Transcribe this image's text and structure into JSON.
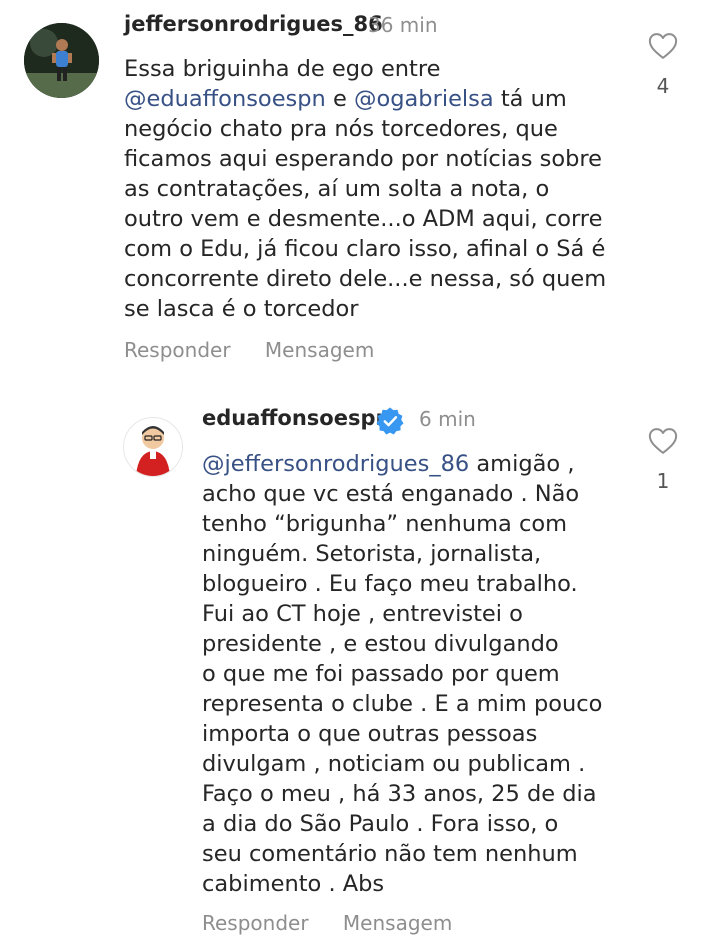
{
  "comments": [
    {
      "username": "jeffersonrodrigues_86",
      "time": "36 min",
      "verified": false,
      "avatar_icon": "user-photo",
      "lines": [
        "Essa briguinha de ego entre",
        "@eduaffonsoespn e @ogabrielsa tá um",
        "negócio chato pra nós torcedores, que",
        "ficamos aqui esperando por notícias sobre",
        "as contratações, aí um solta a nota, o",
        "outro vem e desmente...o ADM aqui, corre",
        "com o Edu, já ficou claro isso, afinal o Sá é",
        "concorrente direto dele...e nessa, só quem",
        "se lasca é o torcedor"
      ],
      "mentions": [
        "@eduaffonsoespn",
        "@ogabrielsa"
      ],
      "like_count": "4",
      "reply_label": "Responder",
      "message_label": "Mensagem"
    },
    {
      "username": "eduaffonsoespn",
      "time": "6 min",
      "verified": true,
      "avatar_icon": "caricature-avatar",
      "lines": [
        "@jeffersonrodrigues_86 amigão ,",
        "acho que vc está enganado . Não",
        "tenho “brigunha” nenhuma com",
        "ninguém. Setorista, jornalista,",
        "blogueiro . Eu faço meu trabalho.",
        "Fui ao CT hoje , entrevistei o",
        "presidente , e estou divulgando",
        "o que me foi passado por quem",
        "representa o clube . E a mim pouco",
        "importa o que outras pessoas",
        "divulgam , noticiam ou publicam .",
        "Faço o meu , há 33 anos, 25 de dia",
        "a dia do São Paulo . Fora isso, o",
        "seu comentário não tem nenhum",
        "cabimento . Abs"
      ],
      "mentions": [
        "@jeffersonrodrigues_86"
      ],
      "like_count": "1",
      "reply_label": "Responder",
      "message_label": "Mensagem"
    }
  ],
  "colors": {
    "text": "#262626",
    "muted": "#8e8e8e",
    "mention": "#385185",
    "verified": "#3897f0"
  },
  "icons": {
    "like": "heart-outline-icon",
    "verified": "verified-badge-icon"
  }
}
